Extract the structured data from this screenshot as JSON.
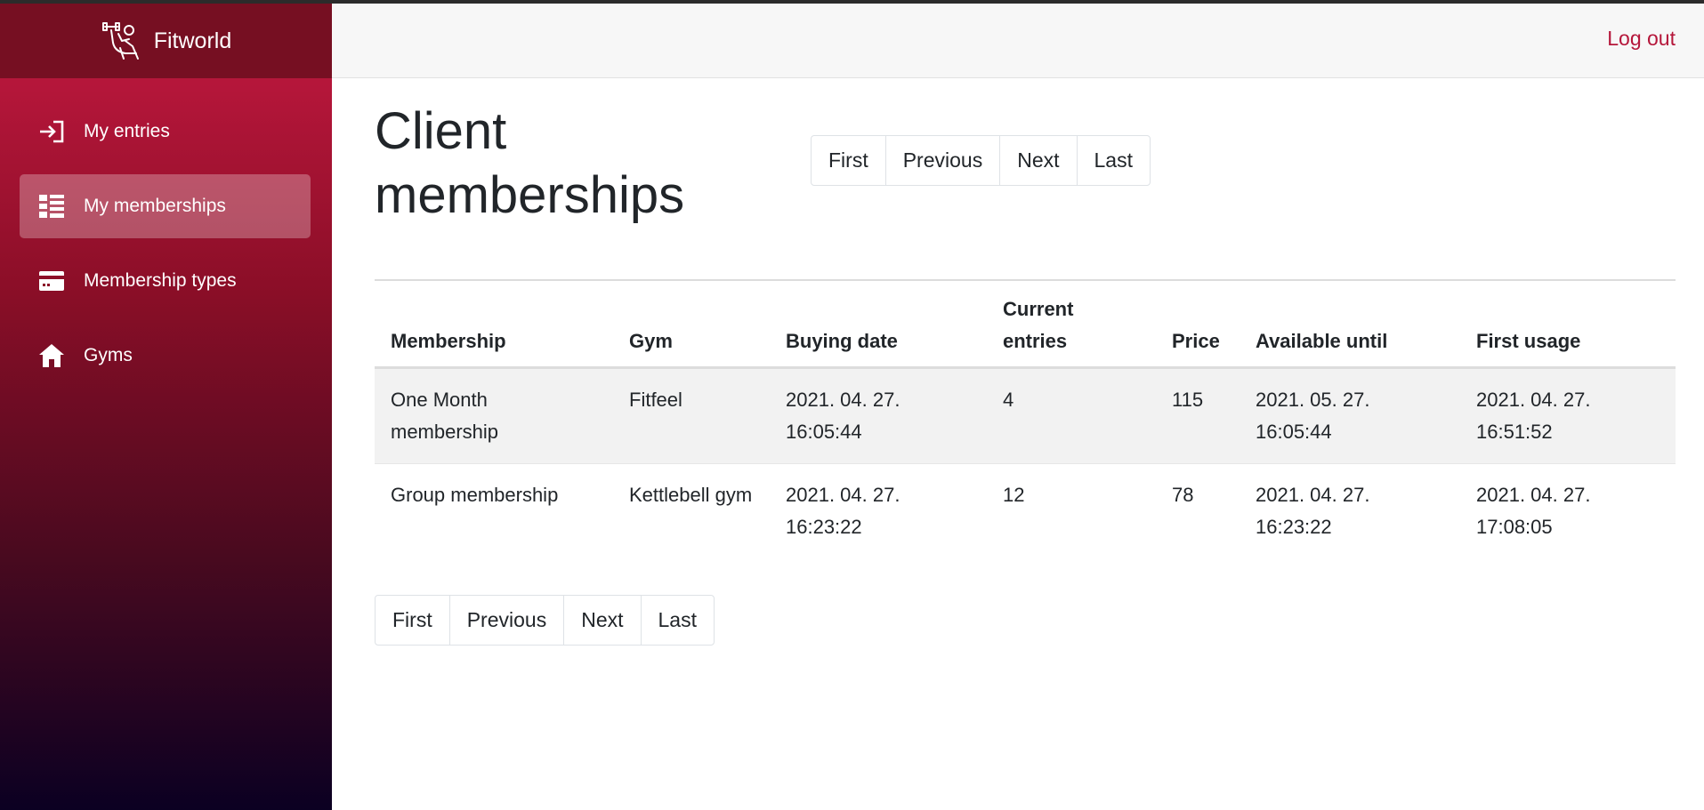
{
  "app": {
    "name": "Fitworld"
  },
  "sidebar": {
    "items": [
      {
        "label": "My entries",
        "icon": "login-arrow-icon",
        "active": false
      },
      {
        "label": "My memberships",
        "icon": "list-view-icon",
        "active": true
      },
      {
        "label": "Membership types",
        "icon": "credit-card-icon",
        "active": false
      },
      {
        "label": "Gyms",
        "icon": "home-icon",
        "active": false
      }
    ]
  },
  "header": {
    "logout_label": "Log out"
  },
  "page": {
    "title": "Client memberships"
  },
  "pagination": {
    "first": "First",
    "previous": "Previous",
    "next": "Next",
    "last": "Last"
  },
  "table": {
    "columns": [
      "Membership",
      "Gym",
      "Buying date",
      "Current entries",
      "Price",
      "Available until",
      "First usage"
    ],
    "rows": [
      [
        "One Month membership",
        "Fitfeel",
        "2021. 04. 27. 16:05:44",
        "4",
        "115",
        "2021. 05. 27. 16:05:44",
        "2021. 04. 27. 16:51:52"
      ],
      [
        "Group membership",
        "Kettlebell gym",
        "2021. 04. 27. 16:23:22",
        "12",
        "78",
        "2021. 04. 27. 16:23:22",
        "2021. 04. 27. 17:08:05"
      ]
    ]
  },
  "colors": {
    "accent": "#b5163a",
    "brand_bar": "#760f22",
    "sidebar_bottom": "#0b0022"
  }
}
